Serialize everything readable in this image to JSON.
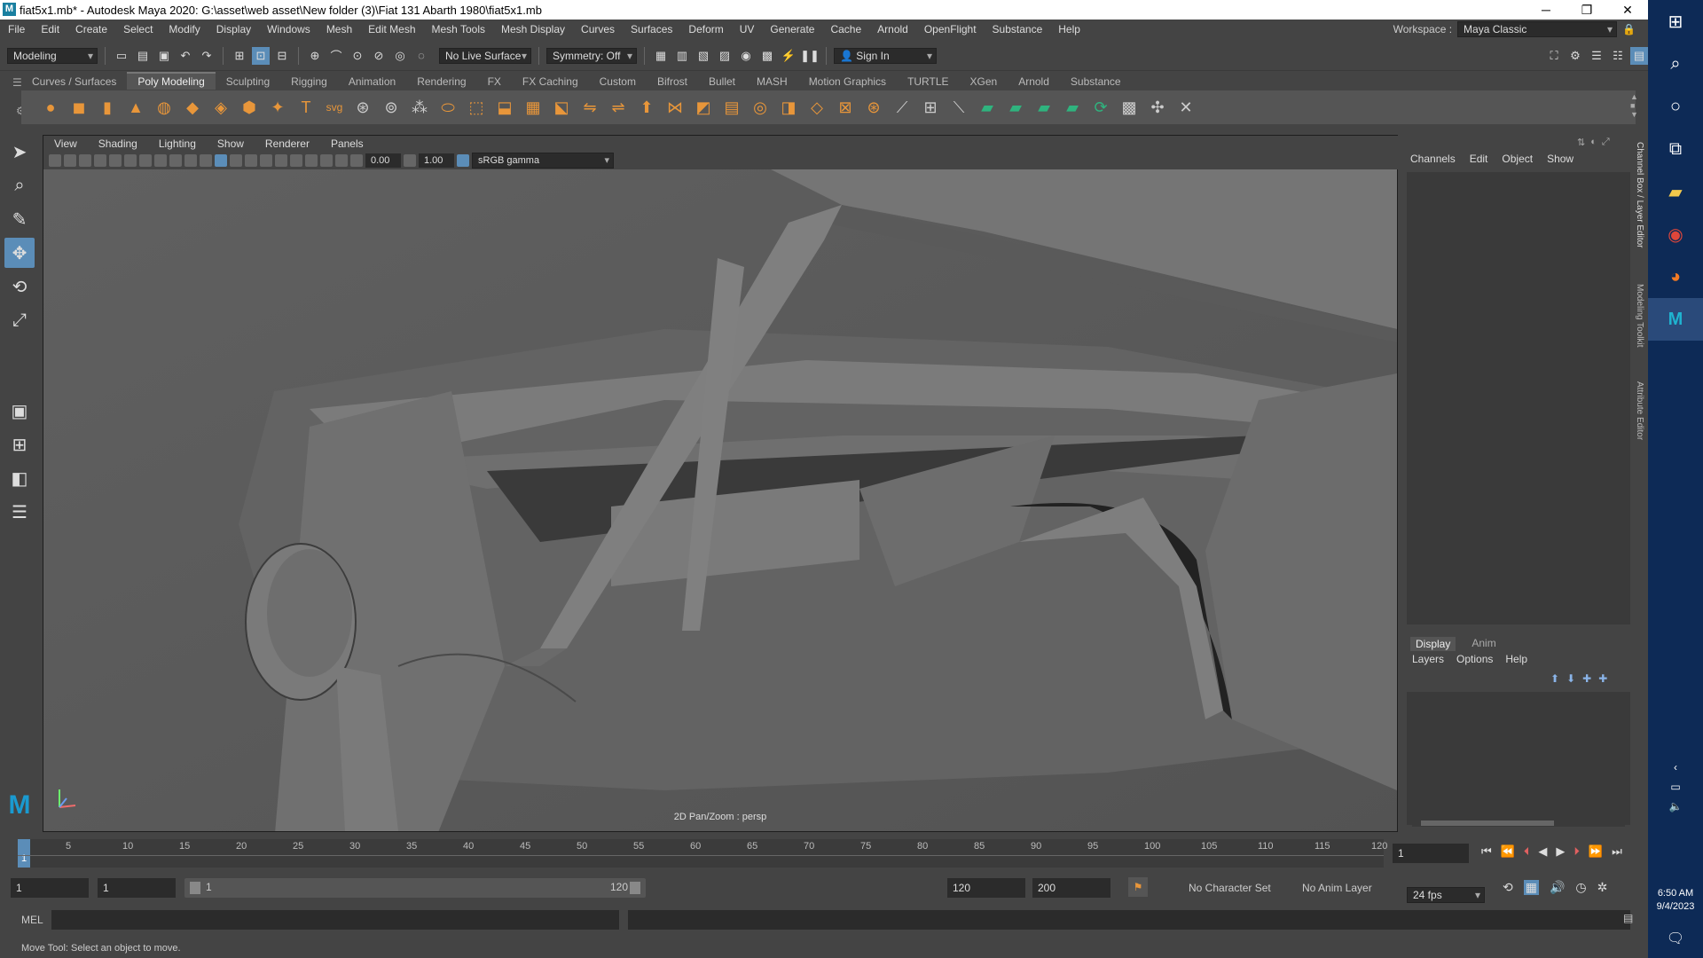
{
  "title": "fiat5x1.mb* - Autodesk Maya 2020: G:\\asset\\web asset\\New folder (3)\\Fiat 131 Abarth 1980\\fiat5x1.mb",
  "menus": [
    "File",
    "Edit",
    "Create",
    "Select",
    "Modify",
    "Display",
    "Windows",
    "Mesh",
    "Edit Mesh",
    "Mesh Tools",
    "Mesh Display",
    "Curves",
    "Surfaces",
    "Deform",
    "UV",
    "Generate",
    "Cache",
    "Arnold",
    "OpenFlight",
    "Substance",
    "Help"
  ],
  "workspace": {
    "label": "Workspace :",
    "value": "Maya Classic"
  },
  "status": {
    "mode": "Modeling",
    "live": "No Live Surface",
    "symmetry": "Symmetry: Off",
    "signin": "Sign In"
  },
  "shelf_tabs": [
    "Curves / Surfaces",
    "Poly Modeling",
    "Sculpting",
    "Rigging",
    "Animation",
    "Rendering",
    "FX",
    "FX Caching",
    "Custom",
    "Bifrost",
    "Bullet",
    "MASH",
    "Motion Graphics",
    "TURTLE",
    "XGen",
    "Arnold",
    "Substance"
  ],
  "viewport": {
    "menus": [
      "View",
      "Shading",
      "Lighting",
      "Show",
      "Renderer",
      "Panels"
    ],
    "val1": "0.00",
    "val2": "1.00",
    "colorspace": "sRGB gamma",
    "hud": "2D Pan/Zoom : persp"
  },
  "channelbox": {
    "tabs": [
      "Channels",
      "Edit",
      "Object",
      "Show"
    ]
  },
  "layers": {
    "tabs": [
      "Display",
      "Anim"
    ],
    "menu": [
      "Layers",
      "Options",
      "Help"
    ]
  },
  "side_tabs": [
    "Channel Box / Layer Editor",
    "Modeling Toolkit",
    "Attribute Editor"
  ],
  "timeline": {
    "labels": [
      "5",
      "10",
      "15",
      "20",
      "25",
      "30",
      "35",
      "40",
      "45",
      "50",
      "55",
      "60",
      "65",
      "70",
      "75",
      "80",
      "85",
      "90",
      "95",
      "100",
      "105",
      "110",
      "115",
      "120"
    ],
    "current": "1",
    "current_field": "1"
  },
  "range": {
    "start": "1",
    "start2": "1",
    "slider_start": "1",
    "slider_end": "120",
    "end": "120",
    "end2": "200",
    "charset": "No Character Set",
    "animlayer": "No Anim Layer",
    "fps": "24 fps"
  },
  "cmd": {
    "label": "MEL"
  },
  "help": "Move Tool: Select an object to move.",
  "clock": {
    "time": "6:50 AM",
    "date": "9/4/2023"
  }
}
